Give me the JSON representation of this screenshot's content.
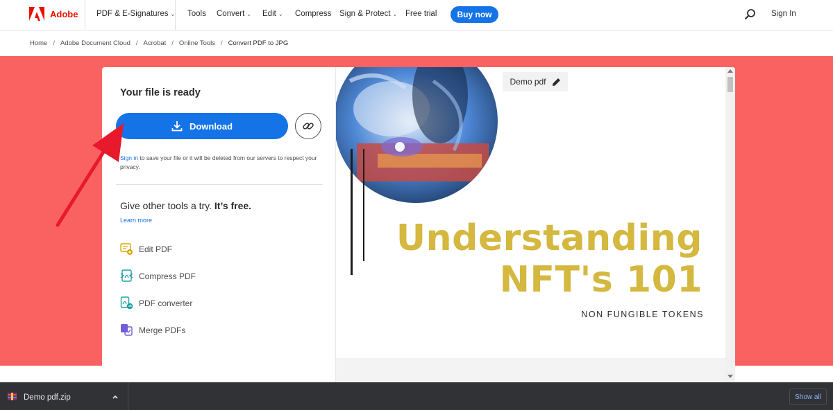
{
  "nav": {
    "brand": "Adobe",
    "items": [
      {
        "label": "PDF & E-Signatures",
        "dropdown": true
      },
      {
        "label": "Tools",
        "dropdown": false
      },
      {
        "label": "Convert",
        "dropdown": true
      },
      {
        "label": "Edit",
        "dropdown": true
      },
      {
        "label": "Compress",
        "dropdown": false
      },
      {
        "label": "Sign & Protect",
        "dropdown": true
      },
      {
        "label": "Free trial",
        "dropdown": false
      }
    ],
    "buy_label": "Buy now",
    "search_icon": "search-icon",
    "signin_label": "Sign In"
  },
  "breadcrumb": [
    "Home",
    "Adobe Document Cloud",
    "Acrobat",
    "Online Tools",
    "Convert PDF to JPG"
  ],
  "panel": {
    "title": "Your file is ready",
    "download_label": "Download",
    "download_icon": "download-icon",
    "share_icon": "link-icon",
    "save_note": {
      "link": "Sign in",
      "text": " to save your file or it will be deleted from our servers to respect your privacy."
    },
    "tools_title_plain": "Give other tools a try. ",
    "tools_title_bold": "It’s free.",
    "learn_more": "Learn more",
    "tools": [
      {
        "label": "Edit PDF",
        "icon": "edit-pdf-icon"
      },
      {
        "label": "Compress PDF",
        "icon": "compress-pdf-icon"
      },
      {
        "label": "PDF converter",
        "icon": "pdf-converter-icon"
      },
      {
        "label": "Merge PDFs",
        "icon": "merge-pdfs-icon"
      }
    ]
  },
  "preview": {
    "file_label": "Demo pdf",
    "edit_icon": "pencil-icon",
    "headline_line1": "Understanding",
    "headline_line2": "NFT's 101",
    "subheadline": "NON FUNGIBLE TOKENS"
  },
  "download_bar": {
    "file_name": "Demo pdf.zip",
    "show_all": "Show all"
  },
  "colors": {
    "accent": "#1473e6",
    "brand": "#eb1000",
    "hero": "#fa6262",
    "headline": "#d4b83f",
    "annotation_arrow": "#e8192c"
  }
}
